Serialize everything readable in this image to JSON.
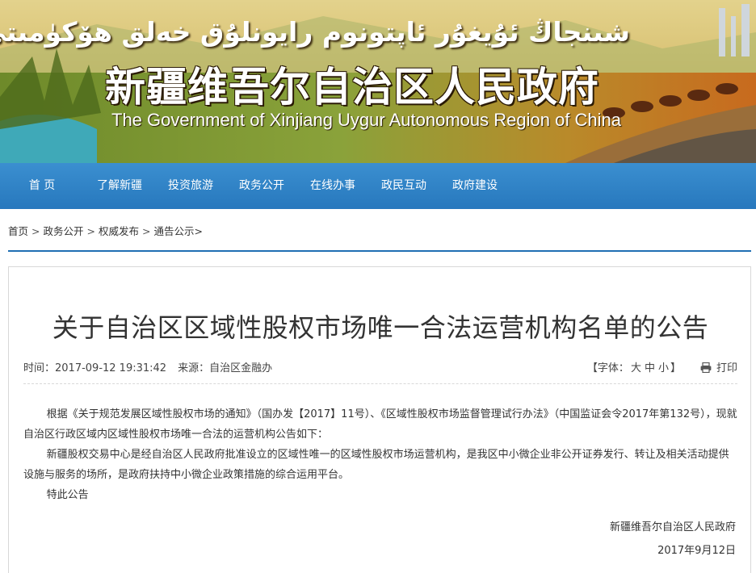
{
  "banner": {
    "uyghur_title": "شىنجاڭ ئۇيغۇر ئاپتونوم رايونلۇق خەلق ھۆكۈمىتى",
    "cn_title": "新疆维吾尔自治区人民政府",
    "en_title": "The Government of Xinjiang Uygur Autonomous Region of China"
  },
  "nav": {
    "items": [
      {
        "label": "首 页"
      },
      {
        "label": "了解新疆"
      },
      {
        "label": "投资旅游"
      },
      {
        "label": "政务公开"
      },
      {
        "label": "在线办事"
      },
      {
        "label": "政民互动"
      },
      {
        "label": "政府建设"
      }
    ]
  },
  "breadcrumb": {
    "items": [
      "首页",
      "政务公开",
      "权威发布",
      "通告公示"
    ],
    "separator": ">"
  },
  "article": {
    "title": "关于自治区区域性股权市场唯一合法运营机构名单的公告",
    "time": "时间：2017-09-12 19:31:42",
    "source": "来源：自治区金融办",
    "font_label": "【字体：",
    "font_sizes": [
      "大",
      "中",
      "小"
    ],
    "font_close": "】",
    "print_label": "打印",
    "paragraphs": [
      "根据《关于规范发展区域性股权市场的通知》（国办发【2017】11号）、《区域性股权市场监督管理试行办法》（中国监证会令2017年第132号），现就自治区行政区域内区域性股权市场唯一合法的运营机构公告如下：",
      "新疆股权交易中心是经自治区人民政府批准设立的区域性唯一的区域性股权市场运营机构，是我区中小微企业非公开证券发行、转让及相关活动提供设施与服务的场所，是政府扶持中小微企业政策措施的综合运用平台。",
      "特此公告"
    ],
    "signature": "新疆维吾尔自治区人民政府",
    "date": "2017年9月12日"
  },
  "colors": {
    "nav_bg": "#2778bd",
    "rule": "#1f6fb3"
  }
}
